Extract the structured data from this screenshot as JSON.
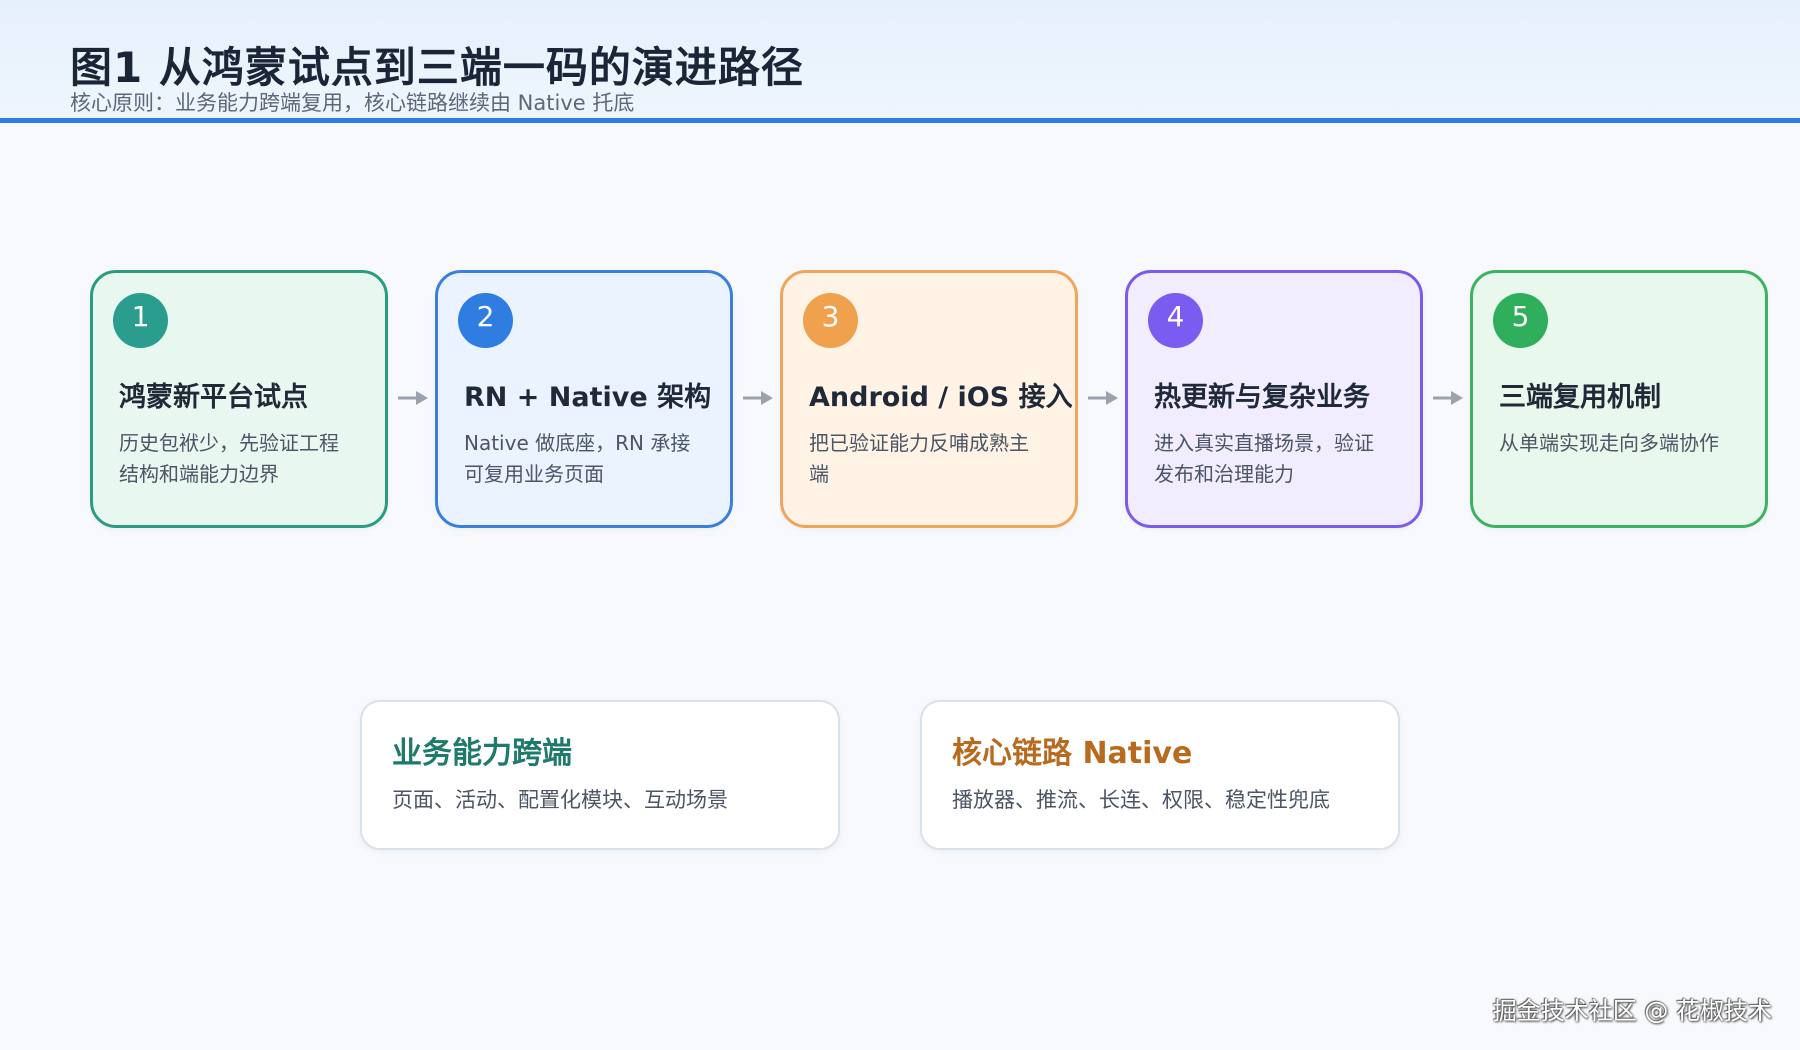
{
  "header": {
    "title": "图1  从鸿蒙试点到三端一码的演进路径",
    "subtitle": "核心原则：业务能力跨端复用，核心链路继续由 Native 托底"
  },
  "steps": [
    {
      "number": "1",
      "title": "鸿蒙新平台试点",
      "desc": "历史包袱少，先验证工程结构和端能力边界",
      "color": "#2a9d8f",
      "bg": "#e9f7f1",
      "border": "#2a9d80"
    },
    {
      "number": "2",
      "title": "RN + Native 架构",
      "desc": "Native 做底座，RN 承接可复用业务页面",
      "color": "#2f7de1",
      "bg": "#eaf3ff",
      "border": "#3a7fe0"
    },
    {
      "number": "3",
      "title": "Android / iOS 接入",
      "desc": "把已验证能力反哺成熟主端",
      "color": "#f0a14d",
      "bg": "#fff3e6",
      "border": "#f0a55c"
    },
    {
      "number": "4",
      "title": "热更新与复杂业务",
      "desc": "进入真实直播场景，验证发布和治理能力",
      "color": "#7b5cf0",
      "bg": "#f1edff",
      "border": "#7b5ce8"
    },
    {
      "number": "5",
      "title": "三端复用机制",
      "desc": "从单端实现走向多端协作",
      "color": "#2fae5b",
      "bg": "#e9f8ec",
      "border": "#3cb363"
    }
  ],
  "cards": [
    {
      "title": "业务能力跨端",
      "desc": "页面、活动、配置化模块、互动场景",
      "color": "#1f7a6b"
    },
    {
      "title": "核心链路 Native",
      "desc": "播放器、推流、长连、权限、稳定性兜底",
      "color": "#b86a1e"
    }
  ],
  "watermark": "掘金技术社区 @ 花椒技术",
  "colors": {
    "accent": "#2f7de1",
    "arrow": "#9aa3ad"
  }
}
